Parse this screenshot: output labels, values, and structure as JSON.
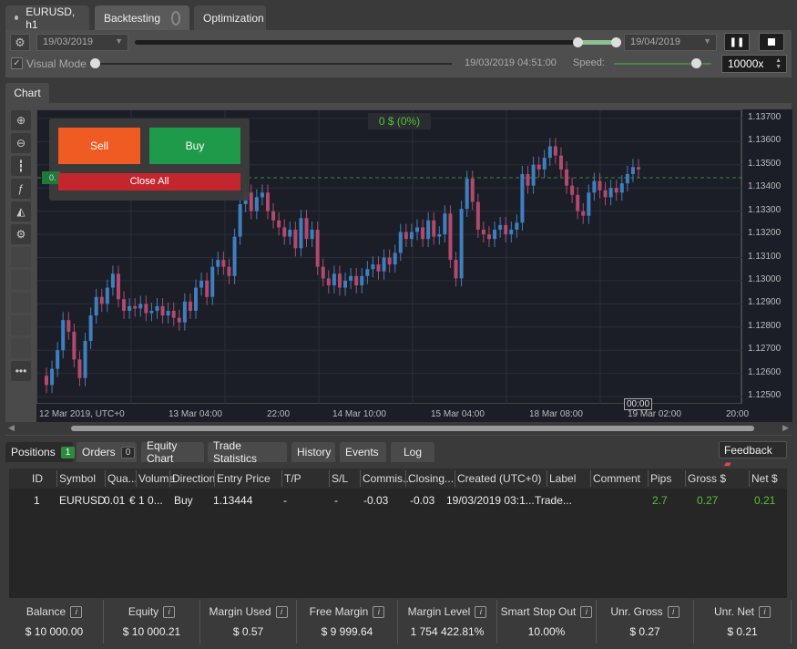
{
  "tabs": {
    "symbol": "EURUSD, h1",
    "backtesting": "Backtesting",
    "optimization": "Optimization"
  },
  "controls": {
    "start_date": "19/03/2019",
    "end_date": "19/04/2019",
    "visual_mode": "Visual Mode",
    "current_time": "19/03/2019 04:51:00",
    "speed_label": "Speed:",
    "speed_value": "10000x"
  },
  "chart_tab": "Chart",
  "trade_panel": {
    "sell": "Sell",
    "buy": "Buy",
    "close_all": "Close All",
    "pnl": "0 $ (0%)",
    "marker": "0."
  },
  "chart_data": {
    "type": "candlestick",
    "symbol": "EURUSD",
    "timeframe": "h1",
    "y_ticks": [
      "1.13700",
      "1.13600",
      "1.13500",
      "1.13400",
      "1.13300",
      "1.13200",
      "1.13100",
      "1.13000",
      "1.12900",
      "1.12800",
      "1.12700",
      "1.12600",
      "1.12500"
    ],
    "ylim": [
      1.12465,
      1.13735
    ],
    "x_ticks": [
      "12 Mar 2019, UTC+0",
      "13 Mar 04:00",
      "22:00",
      "14 Mar 10:00",
      "15 Mar 04:00",
      "18 Mar 08:00",
      "19 Mar 02:00",
      "20:00"
    ],
    "current_price_line": 1.13444,
    "cursor_label": "00:00",
    "closes": [
      1.1255,
      1.1262,
      1.127,
      1.1283,
      1.1278,
      1.1266,
      1.1258,
      1.1274,
      1.1285,
      1.1293,
      1.129,
      1.1297,
      1.1303,
      1.1292,
      1.1287,
      1.1289,
      1.1288,
      1.129,
      1.1286,
      1.1287,
      1.1289,
      1.1285,
      1.1287,
      1.1284,
      1.1282,
      1.1291,
      1.1287,
      1.1297,
      1.13,
      1.1293,
      1.1306,
      1.1309,
      1.1306,
      1.1302,
      1.1319,
      1.1333,
      1.1338,
      1.133,
      1.1336,
      1.1338,
      1.133,
      1.1326,
      1.1323,
      1.1319,
      1.1322,
      1.1314,
      1.1327,
      1.1318,
      1.1322,
      1.1306,
      1.1301,
      1.1298,
      1.1303,
      1.1297,
      1.13,
      1.1302,
      1.1298,
      1.1302,
      1.1305,
      1.1307,
      1.1304,
      1.131,
      1.1307,
      1.1312,
      1.1321,
      1.1318,
      1.1321,
      1.1323,
      1.1318,
      1.1326,
      1.1319,
      1.132,
      1.1329,
      1.1309,
      1.1301,
      1.1331,
      1.1344,
      1.1334,
      1.1322,
      1.132,
      1.1318,
      1.1322,
      1.1324,
      1.132,
      1.1322,
      1.1325,
      1.1346,
      1.1341,
      1.135,
      1.1348,
      1.1353,
      1.1358,
      1.1354,
      1.1348,
      1.1341,
      1.1337,
      1.133,
      1.1328,
      1.1338,
      1.1343,
      1.1339,
      1.1336,
      1.134,
      1.1338,
      1.1342,
      1.1346,
      1.1349,
      1.1348
    ]
  },
  "bottom_tabs": {
    "positions": "Positions",
    "positions_count": "1",
    "orders": "Orders",
    "orders_count": "0",
    "equity_chart": "Equity Chart",
    "trade_statistics": "Trade Statistics",
    "history": "History",
    "events": "Events",
    "log": "Log",
    "feedback": "Feedback"
  },
  "table": {
    "headers": [
      "ID",
      "Symbol",
      "Qua...",
      "Volume",
      "Direction",
      "Entry Price",
      "T/P",
      "S/L",
      "Commis...",
      "Closing...",
      "Created (UTC+0)",
      "Label",
      "Comment",
      "Pips",
      "Gross $",
      "Net $"
    ],
    "row": [
      "1",
      "EURUSD",
      "0.01",
      "€ 1 0...",
      "Buy",
      "1.13444",
      "-",
      "-",
      "-0.03",
      "-0.03",
      "19/03/2019 03:1...",
      "Trade...",
      "",
      "2.7",
      "0.27",
      "0.21"
    ]
  },
  "stats": [
    {
      "label": "Balance",
      "value": "$ 10 000.00"
    },
    {
      "label": "Equity",
      "value": "$ 10 000.21"
    },
    {
      "label": "Margin Used",
      "value": "$ 0.57"
    },
    {
      "label": "Free Margin",
      "value": "$ 9 999.64"
    },
    {
      "label": "Margin Level",
      "value": "1 754 422.81%"
    },
    {
      "label": "Smart Stop Out",
      "value": "10.00%"
    },
    {
      "label": "Unr. Gross",
      "value": "$ 0.27"
    },
    {
      "label": "Unr. Net",
      "value": "$ 0.21"
    }
  ],
  "colors": {
    "bull": "#3f7fbf",
    "bear": "#b04a6e",
    "sell": "#f05a23",
    "buy": "#1f9a4b",
    "close": "#c4262e",
    "profit": "#52c234"
  }
}
